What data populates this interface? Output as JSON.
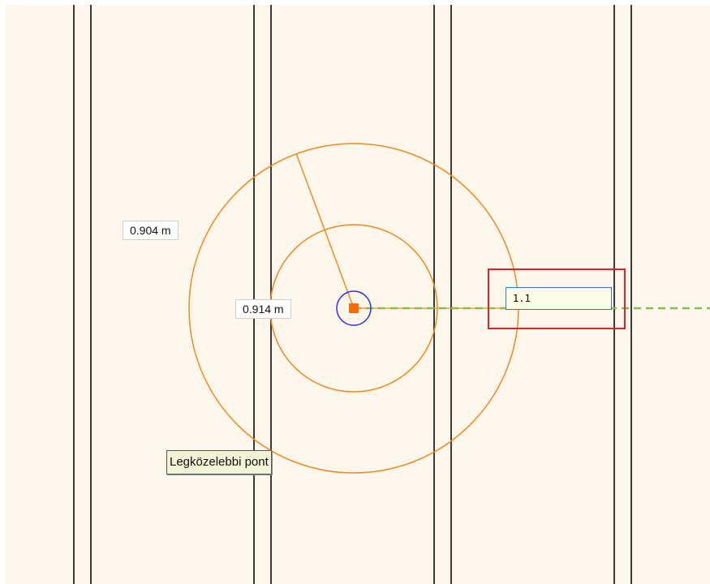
{
  "canvas": {
    "background_color": "#fdf6ea",
    "wall_line_color": "#3a3a3a",
    "circle_color": "#f08a24",
    "guide_line_color": "#7cc250",
    "snap_marker_color": "#3030e0",
    "center_point_color": "#ff6a00"
  },
  "dimensions": {
    "outer_radius_label": "0.904 m",
    "inner_radius_label": "0.914 m"
  },
  "length_input": {
    "value": "1.1",
    "highlight_color": "#e0202a"
  },
  "tooltip": {
    "text": "Legközelebbi pont"
  }
}
